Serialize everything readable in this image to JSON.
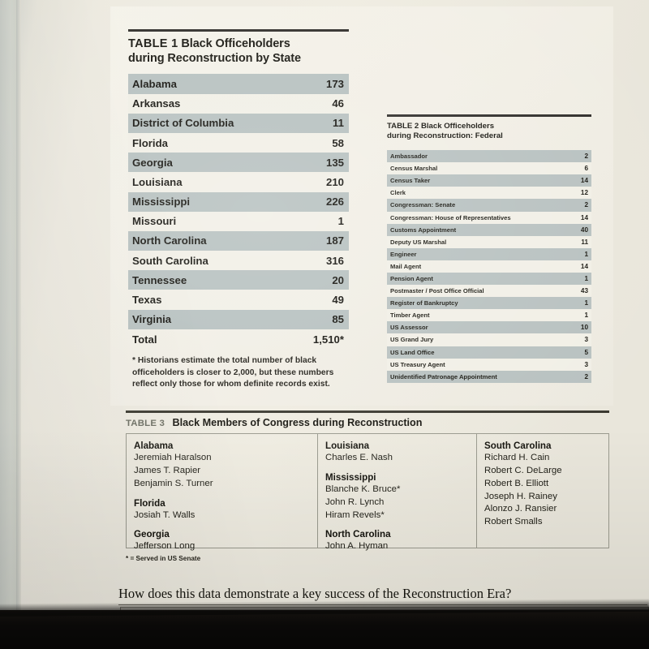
{
  "page": {
    "question": "How does this data demonstrate a key success of the Reconstruction Era?"
  },
  "table1": {
    "label": "TABLE 1",
    "title": "Black Officeholders during Reconstruction by State",
    "title_line1": "Black Officeholders",
    "title_line2": "during Reconstruction by State",
    "rows": [
      {
        "state": "Alabama",
        "count": "173"
      },
      {
        "state": "Arkansas",
        "count": "46"
      },
      {
        "state": "District of Columbia",
        "count": "11"
      },
      {
        "state": "Florida",
        "count": "58"
      },
      {
        "state": "Georgia",
        "count": "135"
      },
      {
        "state": "Louisiana",
        "count": "210"
      },
      {
        "state": "Mississippi",
        "count": "226"
      },
      {
        "state": "Missouri",
        "count": "1"
      },
      {
        "state": "North Carolina",
        "count": "187"
      },
      {
        "state": "South Carolina",
        "count": "316"
      },
      {
        "state": "Tennessee",
        "count": "20"
      },
      {
        "state": "Texas",
        "count": "49"
      },
      {
        "state": "Virginia",
        "count": "85"
      }
    ],
    "total_label": "Total",
    "total_value": "1,510*",
    "note": "* Historians estimate the total number of black officeholders is closer to 2,000, but these numbers reflect only those for whom definite records exist."
  },
  "table2": {
    "label": "TABLE 2",
    "title_line1": "Black Officeholders",
    "title_line2": "during Reconstruction: Federal",
    "rows": [
      {
        "office": "Ambassador",
        "count": "2"
      },
      {
        "office": "Census Marshal",
        "count": "6"
      },
      {
        "office": "Census Taker",
        "count": "14"
      },
      {
        "office": "Clerk",
        "count": "12"
      },
      {
        "office": "Congressman: Senate",
        "count": "2"
      },
      {
        "office": "Congressman: House of Representatives",
        "count": "14"
      },
      {
        "office": "Customs Appointment",
        "count": "40"
      },
      {
        "office": "Deputy US Marshal",
        "count": "11"
      },
      {
        "office": "Engineer",
        "count": "1"
      },
      {
        "office": "Mail Agent",
        "count": "14"
      },
      {
        "office": "Pension Agent",
        "count": "1"
      },
      {
        "office": "Postmaster / Post Office Official",
        "count": "43"
      },
      {
        "office": "Register of Bankruptcy",
        "count": "1"
      },
      {
        "office": "Timber Agent",
        "count": "1"
      },
      {
        "office": "US Assessor",
        "count": "10"
      },
      {
        "office": "US Grand Jury",
        "count": "3"
      },
      {
        "office": "US Land Office",
        "count": "5"
      },
      {
        "office": "US Treasury Agent",
        "count": "3"
      },
      {
        "office": "Unidentified Patronage Appointment",
        "count": "2"
      }
    ]
  },
  "table3": {
    "label": "TABLE 3",
    "title": "Black Members of Congress during Reconstruction",
    "columns": [
      {
        "groups": [
          {
            "state": "Alabama",
            "members": [
              "Jeremiah Haralson",
              "James T. Rapier",
              "Benjamin S. Turner"
            ]
          },
          {
            "state": "Florida",
            "members": [
              "Josiah T. Walls"
            ]
          },
          {
            "state": "Georgia",
            "members": [
              "Jefferson Long"
            ]
          }
        ]
      },
      {
        "groups": [
          {
            "state": "Louisiana",
            "members": [
              "Charles E. Nash"
            ]
          },
          {
            "state": "Mississippi",
            "members": [
              "Blanche K. Bruce*",
              "John R. Lynch",
              "Hiram Revels*"
            ]
          },
          {
            "state": "North Carolina",
            "members": [
              "John A. Hyman"
            ]
          }
        ]
      },
      {
        "groups": [
          {
            "state": "South Carolina",
            "members": [
              "Richard H. Cain",
              "Robert C. DeLarge",
              "Robert B. Elliott",
              "Joseph H. Rainey",
              "Alonzo J. Ransier",
              "Robert Smalls"
            ]
          }
        ]
      }
    ],
    "note": "* = Served in US Senate"
  },
  "colors": {
    "stripe": "#b6c0bf",
    "paper": "#f1efe6",
    "ink": "#16150f"
  }
}
